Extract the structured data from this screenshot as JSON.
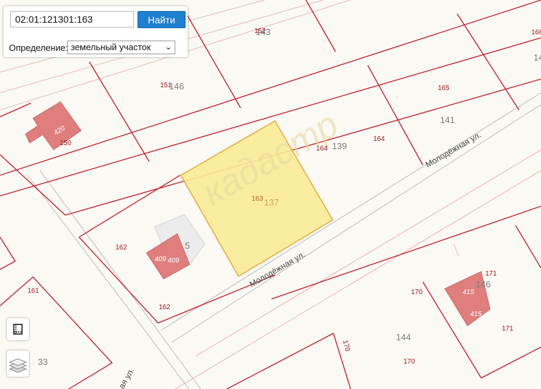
{
  "search": {
    "value": "02:01:121301:163",
    "button_label": "Найти"
  },
  "definition": {
    "label": "Определение:",
    "selected": "земельный участок"
  },
  "map": {
    "streets": [
      "Молодёжная ул.",
      "Молодёжная ул.",
      "ая ул."
    ],
    "parcel_labels": [
      "152",
      "151",
      "150",
      "165",
      "164",
      "164",
      "162",
      "162",
      "161",
      "171",
      "171",
      "170",
      "170",
      "170",
      "166"
    ],
    "quarter_labels": [
      "143",
      "146",
      "141",
      "139",
      "137",
      "5",
      "146",
      "144",
      "33",
      "14"
    ],
    "building_labels": [
      "420",
      "409",
      "409",
      "415",
      "415"
    ],
    "selected_parcel_label": "163",
    "watermark": "кадастр",
    "colors": {
      "selected_fill": "#fbeb97",
      "selected_stroke": "#e8a636",
      "boundary": "#c0162d",
      "building": "#e07e7e",
      "background": "#faf9f4"
    }
  },
  "controls": {
    "measure_icon": "ruler-icon",
    "layers_icon": "layers-icon"
  }
}
